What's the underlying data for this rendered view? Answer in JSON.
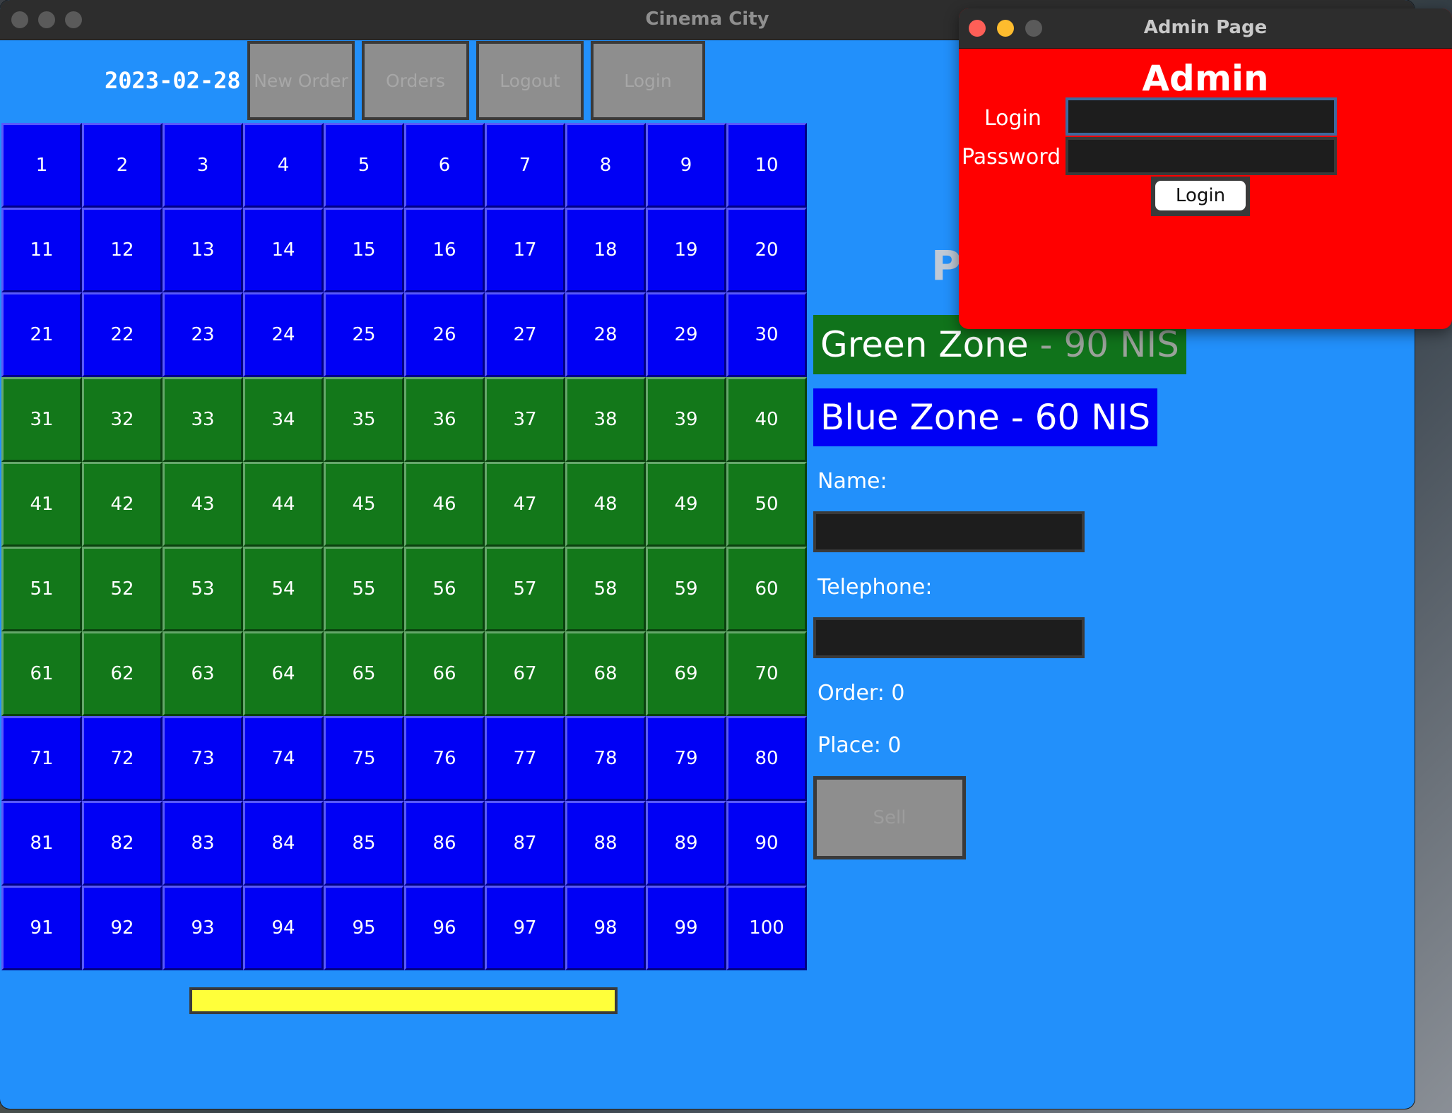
{
  "main_window": {
    "title": "Cinema City",
    "date": "2023-02-28",
    "toolbar": {
      "new_order": "New Order",
      "orders": "Orders",
      "logout": "Logout",
      "login": "Login"
    },
    "seats": [
      "1",
      "2",
      "3",
      "4",
      "5",
      "6",
      "7",
      "8",
      "9",
      "10",
      "11",
      "12",
      "13",
      "14",
      "15",
      "16",
      "17",
      "18",
      "19",
      "20",
      "21",
      "22",
      "23",
      "24",
      "25",
      "26",
      "27",
      "28",
      "29",
      "30",
      "31",
      "32",
      "33",
      "34",
      "35",
      "36",
      "37",
      "38",
      "39",
      "40",
      "41",
      "42",
      "43",
      "44",
      "45",
      "46",
      "47",
      "48",
      "49",
      "50",
      "51",
      "52",
      "53",
      "54",
      "55",
      "56",
      "57",
      "58",
      "59",
      "60",
      "61",
      "62",
      "63",
      "64",
      "65",
      "66",
      "67",
      "68",
      "69",
      "70",
      "71",
      "72",
      "73",
      "74",
      "75",
      "76",
      "77",
      "78",
      "79",
      "80",
      "81",
      "82",
      "83",
      "84",
      "85",
      "86",
      "87",
      "88",
      "89",
      "90",
      "91",
      "92",
      "93",
      "94",
      "95",
      "96",
      "97",
      "98",
      "99",
      "100"
    ],
    "seat_zones": [
      "blue",
      "blue",
      "blue",
      "green",
      "green",
      "green",
      "green",
      "blue",
      "blue",
      "blue"
    ],
    "zone_colors": {
      "blue": "#0000f5",
      "green": "#13781a"
    },
    "partial_title": "P",
    "green_zone": {
      "prefix": "Green Zone",
      "separator": " - ",
      "price": "90 NIS"
    },
    "blue_zone": "Blue Zone - 60 NIS",
    "name_label": "Name:",
    "name_value": "",
    "telephone_label": "Telephone:",
    "telephone_value": "",
    "order_text": "Order: 0",
    "place_text": "Place: 0",
    "sell_label": "Sell",
    "progress_fraction": 1.0
  },
  "admin_window": {
    "title": "Admin Page",
    "heading": "Admin",
    "login_label": "Login",
    "login_value": "",
    "password_label": "Password",
    "password_value": "",
    "login_button": "Login"
  }
}
